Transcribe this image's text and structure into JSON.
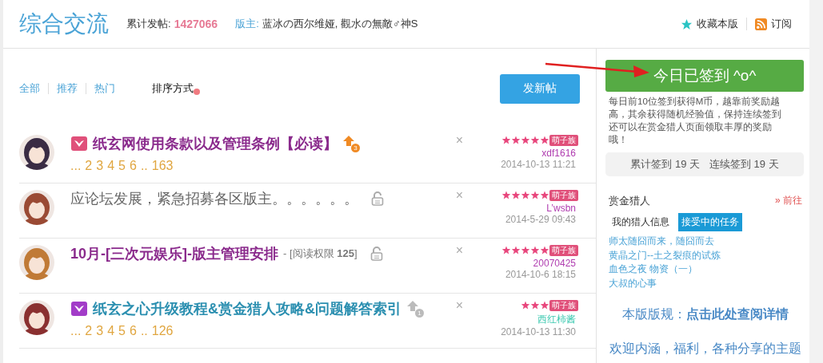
{
  "header": {
    "title": "综合交流",
    "post_count_label": "累计发帖:",
    "post_count": "1427066",
    "moderators_label": "版主:",
    "moderators": "蓝冰の西尔维娅, 觀水の無敵♂神S",
    "actions": [
      {
        "kind": "favorite",
        "label": "收藏本版"
      },
      {
        "kind": "rss",
        "label": "订阅"
      }
    ]
  },
  "filters": {
    "tabs": [
      "全部",
      "推荐",
      "热门"
    ],
    "sort_label": "排序方式",
    "new_post_button": "发新帖"
  },
  "threads": [
    {
      "kind": "notice",
      "tag": {
        "color": "#e0507a"
      },
      "title": "纸玄网使用条款以及管理条例【必读】",
      "hot": {
        "active": true,
        "count": "3"
      },
      "locked": false,
      "pages": [
        "...",
        "2",
        "3",
        "4",
        "5",
        "6",
        "..",
        "163"
      ],
      "close": "×",
      "stars": 5,
      "badge": "萌子族",
      "author": "xdf1616",
      "author_highlight": false,
      "time": "2014-10-13 11:21"
    },
    {
      "kind": "plain",
      "title": "应论坛发展，紧急招募各区版主。。。。。。",
      "locked": true,
      "close": "×",
      "stars": 5,
      "badge": "萌子族",
      "author": "L’wsbn",
      "author_highlight": false,
      "time": "2014-5-29 09:43"
    },
    {
      "kind": "notice",
      "title": "10月-[三次元娱乐]-版主管理安排",
      "suffix": "- [阅读权限 **125**]",
      "locked": true,
      "close": "×",
      "stars": 5,
      "badge": "萌子族",
      "author": "20070425",
      "author_highlight": false,
      "time": "2014-10-6 18:15"
    },
    {
      "kind": "guide",
      "tag": {
        "color": "#a23cc8"
      },
      "title": "纸玄之心升级教程&赏金猎人攻略&问题解答索引",
      "hot": {
        "active": false,
        "count": "1"
      },
      "locked": false,
      "pages": [
        "...",
        "2",
        "3",
        "4",
        "5",
        "6",
        "..",
        "126"
      ],
      "close": "×",
      "stars": 3,
      "badge": "萌子族",
      "author": "西红柿酱",
      "author_highlight": true,
      "time": "2014-10-13 11:30"
    }
  ],
  "sidebar": {
    "sign_button": "今日已签到 ^o^",
    "sign_note": "每日前10位签到获得M币，越靠前奖励越高，其余获得随机经验值，保持连续签到还可以在赏金猎人页面领取丰厚的奖励哦！",
    "stats": [
      "累计签到 19 天",
      "连续签到 19 天"
    ],
    "bounty": {
      "title": "赏金猎人",
      "more": "» 前往",
      "tabs": [
        {
          "label": "我的猎人信息",
          "selected": false
        },
        {
          "label": "接受中的任务",
          "selected": true
        }
      ],
      "tasks": [
        "师太随囧而来，随囧而去",
        "黄晶之门--土之裂痕的试炼",
        "血色之夜 物资（一）",
        "大叔的心事"
      ]
    },
    "rules": "本版版规：**点击此处查阅详情**",
    "welcome": "欢迎内涵，福利，各种分享的主题"
  }
}
